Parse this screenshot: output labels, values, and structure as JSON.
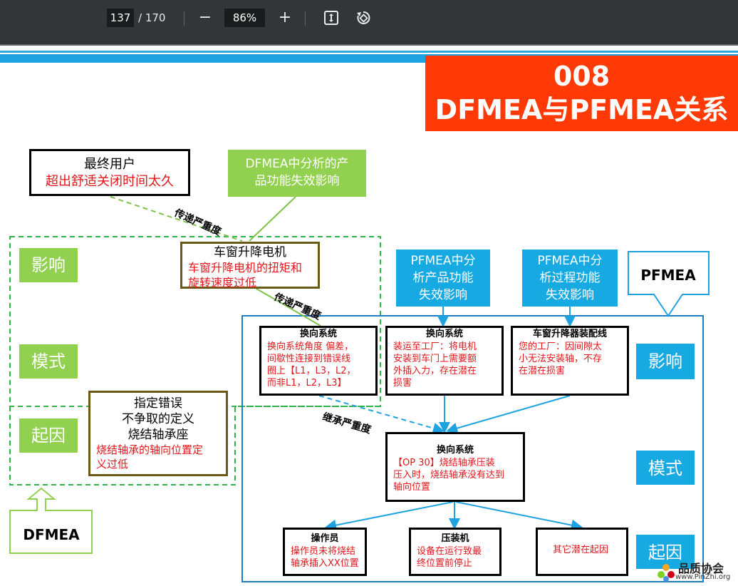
{
  "toolbar": {
    "page_current": "137",
    "page_total": "/ 170",
    "zoom_out": "−",
    "zoom_value": "86%",
    "zoom_in": "+",
    "fit_icon": "fit-page-icon",
    "rotate_icon": "rotate-icon"
  },
  "slide": {
    "title_number": "008",
    "title_text": "DFMEA与PFMEA关系",
    "end_user": {
      "title": "最终用户",
      "text": "超出舒适关闭时间太久"
    },
    "dfmea_func": {
      "line1": "DFMEA中分析的产",
      "line2": "品功能失效影响"
    },
    "motor": {
      "title": "车窗升降电机",
      "line1": "车窗升降电机的扭矩和",
      "line2": "旋转速度过低"
    },
    "left_labels": {
      "effect": "影响",
      "mode": "模式",
      "cause": "起因"
    },
    "spec": {
      "line1": "指定错误",
      "line2": "不争取的定义",
      "line3": "烧结轴承座",
      "red1": "烧结轴承的轴向位置定",
      "red2": "义过低"
    },
    "pfmea_prod": {
      "line1": "PFMEA中分",
      "line2": "析产品功能",
      "line3": "失效影响"
    },
    "pfmea_proc": {
      "line1": "PFMEA中分",
      "line2": "析过程功能",
      "line3": "失效影响"
    },
    "pfmea_label": "PFMEA",
    "dfmea_label": "DFMEA",
    "right_labels": {
      "effect": "影响",
      "mode": "模式",
      "cause": "起因"
    },
    "box1": {
      "title": "换向系统",
      "l1": "换向系统角度 偏差，",
      "l2": "间歇性连接到错误线",
      "l3": "圈上【L1，L3，L2，",
      "l4": "而非L1，L2，L3】"
    },
    "box2": {
      "title": "换向系统",
      "l1": "装运至工厂：将电机",
      "l2": "安装到车门上需要额",
      "l3": "外插入力，存在潜在",
      "l4": "损害"
    },
    "box3": {
      "title": "车窗升降器装配线",
      "l1": "您的工厂：因间隙太",
      "l2": "小无法安装轴，不存",
      "l3": "在潜在损害"
    },
    "box4": {
      "title": "换向系统",
      "l1": "【OP 30】烧结轴承压装",
      "l2": "压入时，烧结轴承没有达到",
      "l3": "轴向位置"
    },
    "box5": {
      "title": "操作员",
      "l1": "操作员未将烧结",
      "l2": "轴承插入XX位置"
    },
    "box6": {
      "title": "压装机",
      "l1": "设备在运行致最",
      "l2": "终位置前停止"
    },
    "box7": {
      "l1": "其它潜在起因"
    },
    "labels": {
      "transfer1": "传递严重度",
      "transfer2": "传递严重度",
      "inherit": "继承严重度"
    },
    "brand": {
      "cn": "品质协会",
      "url": "www.PinZhi.org"
    }
  },
  "colors": {
    "toolbar_bg": "#323639",
    "title_red": "#ff3a06",
    "green": "#92d050",
    "blue": "#17a9e1",
    "text_red": "#e0161b"
  }
}
